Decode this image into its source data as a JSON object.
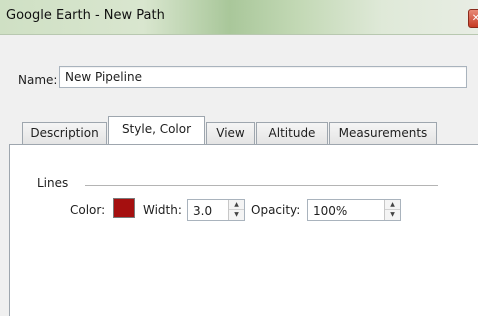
{
  "window": {
    "title": "Google Earth - New Path",
    "close_icon": "close-icon"
  },
  "name_field": {
    "label": "Name:",
    "value": "New Pipeline"
  },
  "tabs": [
    {
      "label": "Description",
      "active": false
    },
    {
      "label": "Style, Color",
      "active": true
    },
    {
      "label": "View",
      "active": false
    },
    {
      "label": "Altitude",
      "active": false
    },
    {
      "label": "Measurements",
      "active": false
    }
  ],
  "lines_section": {
    "heading": "Lines",
    "color_label": "Color:",
    "color_value": "#a50f0f",
    "width_label": "Width:",
    "width_value": "3.0",
    "opacity_label": "Opacity:",
    "opacity_value": "100%"
  },
  "colors": {
    "titlebar_accent": "#a9c79a",
    "close_button": "#c63b24"
  }
}
